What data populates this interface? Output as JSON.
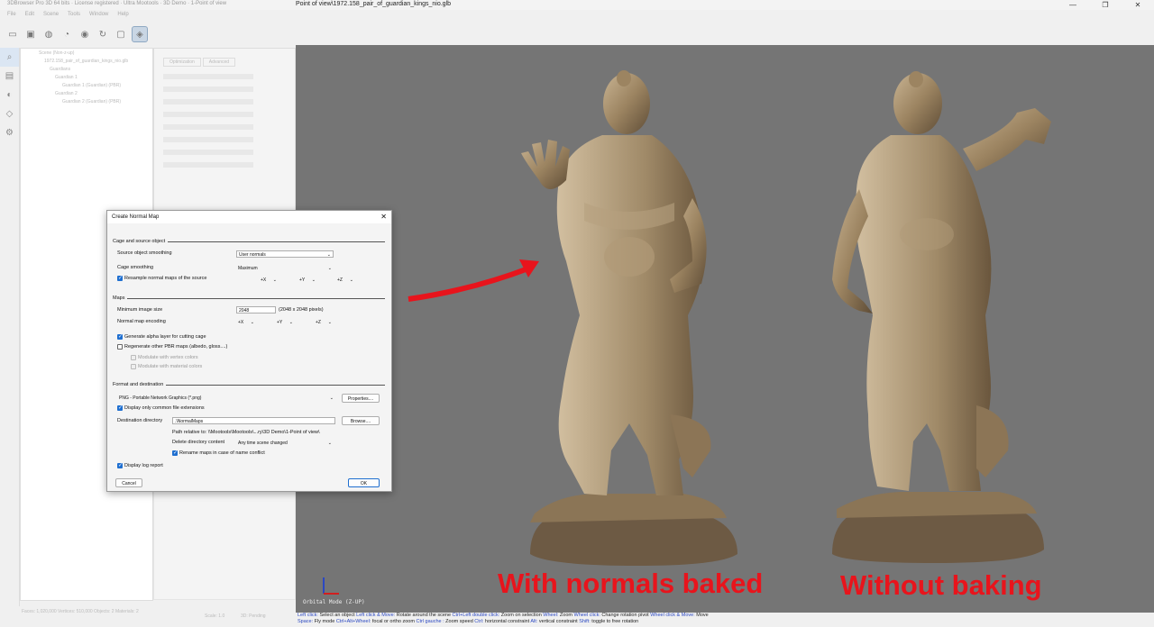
{
  "app": {
    "title_faded": "3DBrowser Pro 3D 64 bits · License registered · Ultra Mootools · 3D Demo · 1-Point of view",
    "document_title": "Point of view\\1972.158_pair_of_guardian_kings_nio.glb",
    "menu": [
      "File",
      "Edit",
      "Scene",
      "Tools",
      "Window",
      "Help"
    ]
  },
  "tree": {
    "items": [
      "Scene (Non-z-up)",
      "1972.158_pair_of_guardian_kings_nio.glb",
      "Guardians",
      "Guardian 1",
      "Guardian 1 (Guardian) (PBR)",
      "Guardian 2",
      "Guardian 2 (Guardian) (PBR)"
    ]
  },
  "props": {
    "tabs": [
      "Optimization",
      "Advanced"
    ]
  },
  "status": {
    "left": "Faces: 1,020,000  Vertices: 510,000  Objects: 2  Materials: 2",
    "mid": "Scale: 1.0",
    "right": "3D: Pending"
  },
  "dialog": {
    "title": "Create Normal Map",
    "close": "✕",
    "cage_section": "Cage and source object",
    "source_smoothing_label": "Source object smoothing",
    "source_smoothing_value": "User normals",
    "cage_smoothing_label": "Cage smoothing",
    "cage_smoothing_value": "Maximum",
    "resample_label": "Resample normal maps of the source",
    "resample_axes": [
      "+X",
      "+Y",
      "+Z"
    ],
    "maps_section": "Maps",
    "min_size_label": "Minimum image size",
    "min_size_value": "2048",
    "min_size_note": "(2048 x 2048 pixels)",
    "encoding_label": "Normal map encoding",
    "encoding_axes": [
      "+X",
      "+Y",
      "+Z"
    ],
    "alpha_label": "Generate alpha layer for cutting cage",
    "regen_label": "Regenerate other PBR maps (albedo, gloss....)",
    "vertex_colors_label": "Modulate with vertex colors",
    "material_colors_label": "Modulate with material colors",
    "format_section": "Format and destination",
    "format_value": "PNG - Portable Network Graphics (*.png)",
    "properties_button": "Properties....",
    "common_ext_label": "Display only common file extensions",
    "dest_dir_label": "Destination directory",
    "dest_dir_value": ".\\NormalMaps",
    "browse_button": "Browse....",
    "path_relative": "Path relative to: \\\\Mootools\\Mootools\\...ry\\3D Demo\\1-Point of view\\",
    "delete_label": "Delete directory content",
    "delete_value": "Any time scene changed",
    "rename_label": "Rename maps in case of name conflict",
    "log_label": "Display log report",
    "cancel_button": "Cancel",
    "ok_button": "OK"
  },
  "viewport": {
    "mode": "Orbital Mode (Z-UP)",
    "caption_left": "With normals baked",
    "caption_right": "Without baking",
    "arrow_color": "#e8141c",
    "background": "#757575"
  },
  "footer": {
    "line1": [
      {
        "k": "Left click:",
        "v": " Select an object "
      },
      {
        "k": "Left click & Move:",
        "v": " Rotate around the scene "
      },
      {
        "k": "Ctrl+Left double click:",
        "v": " Zoom on selection "
      },
      {
        "k": "Wheel:",
        "v": " Zoom "
      },
      {
        "k": "Wheel click:",
        "v": " Change rotation pivot "
      },
      {
        "k": "Wheel click & Move:",
        "v": " Move"
      }
    ],
    "line2": [
      {
        "k": "Space:",
        "v": " Fly mode "
      },
      {
        "k": "Ctrl+Alt+Wheel:",
        "v": " focal or ortho zoom "
      },
      {
        "k": "Ctrl gauche :",
        "v": " Zoom speed "
      },
      {
        "k": "Ctrl:",
        "v": " horizontal constraint "
      },
      {
        "k": "Alt:",
        "v": " vertical constraint "
      },
      {
        "k": "Shift:",
        "v": " toggle to free rotation"
      }
    ]
  }
}
